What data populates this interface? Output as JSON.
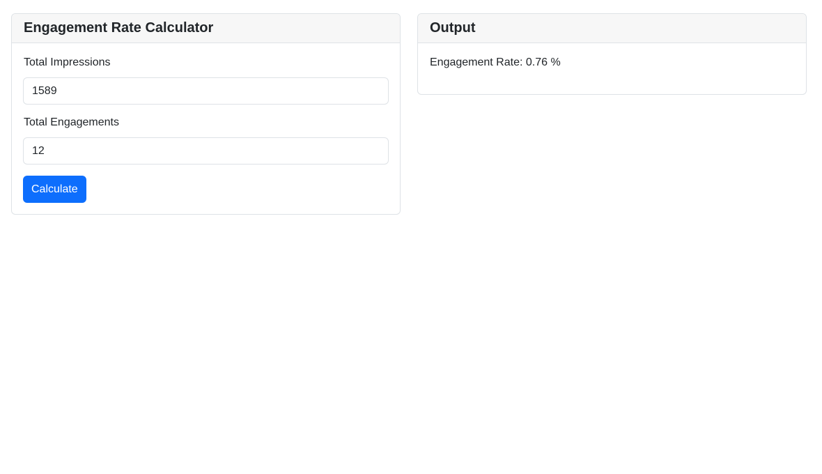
{
  "calculator": {
    "title": "Engagement Rate Calculator",
    "impressions_label": "Total Impressions",
    "impressions_value": "1589",
    "engagements_label": "Total Engagements",
    "engagements_value": "12",
    "calculate_label": "Calculate"
  },
  "output": {
    "title": "Output",
    "result_label": "Engagement Rate:",
    "result_value": "0.76",
    "result_unit": "%"
  },
  "colors": {
    "accent": "#0d6efd",
    "header_bg": "#f7f7f7",
    "border": "#dee2e6"
  }
}
